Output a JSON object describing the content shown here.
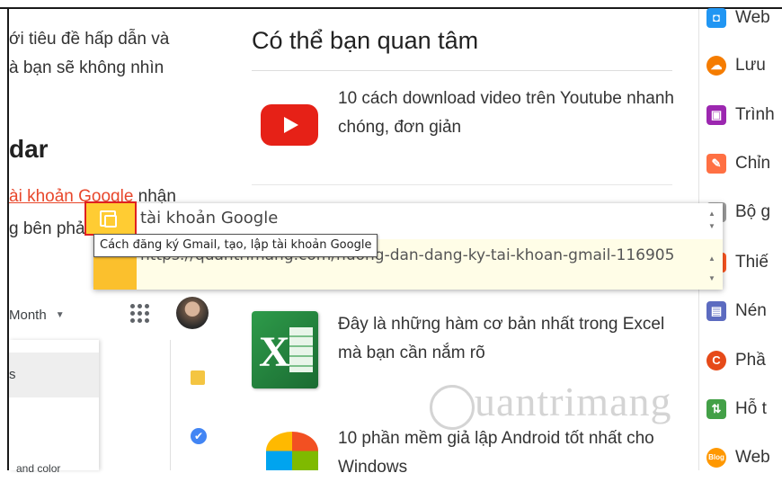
{
  "article": {
    "line1": "ới tiêu đề hấp dẫn và",
    "line2": "à bạn sẽ không nhìn",
    "heading": "dar",
    "link": "ài khoản Google",
    "after_link": " nhận",
    "line4": "g bên phải"
  },
  "calendar": {
    "view_select": "Month",
    "panel_item": "s",
    "panel_bottom": "and color"
  },
  "related": {
    "title": "Có thể bạn quan tâm",
    "items": [
      {
        "text": "10 cách download video trên Youtube nhanh chóng, đơn giản",
        "icon": "youtube-icon"
      },
      {
        "text": "Đây là những hàm cơ bản nhất trong Excel mà bạn cần nắm rõ",
        "icon": "excel-icon"
      },
      {
        "text": "10 phần mềm giả lập Android tốt nhất cho Windows",
        "icon": "windows-icon"
      }
    ]
  },
  "sidebar": {
    "items": [
      {
        "label": "Web",
        "icon": "web-icon",
        "color": "#2196f3"
      },
      {
        "label": "Lưu",
        "icon": "cloud-icon",
        "color": "#f57c00"
      },
      {
        "label": "Trình",
        "icon": "presentation-icon",
        "color": "#9c27b0"
      },
      {
        "label": "Chỉn",
        "icon": "edit-icon",
        "color": "#ff7043"
      },
      {
        "label": "Bộ g",
        "icon": "font-icon",
        "color": "#757575"
      },
      {
        "label": "Thiế",
        "icon": "design-icon",
        "color": "#ff5722"
      },
      {
        "label": "Nén",
        "icon": "compress-icon",
        "color": "#5c6bc0"
      },
      {
        "label": "Phầ",
        "icon": "software-icon",
        "color": "#e64a19"
      },
      {
        "label": "Hỗ t",
        "icon": "support-icon",
        "color": "#43a047"
      },
      {
        "label": "Web",
        "icon": "blog-icon",
        "color": "#ff9800"
      }
    ]
  },
  "popup": {
    "search_value": "tài khoản Google",
    "url": "https://quantrimang.com/huong-dan-dang-ky-tai-khoan-gmail-116905",
    "tooltip": "Cách đăng ký Gmail, tạo, lập tài khoản Google"
  },
  "watermark": "uantrimang"
}
